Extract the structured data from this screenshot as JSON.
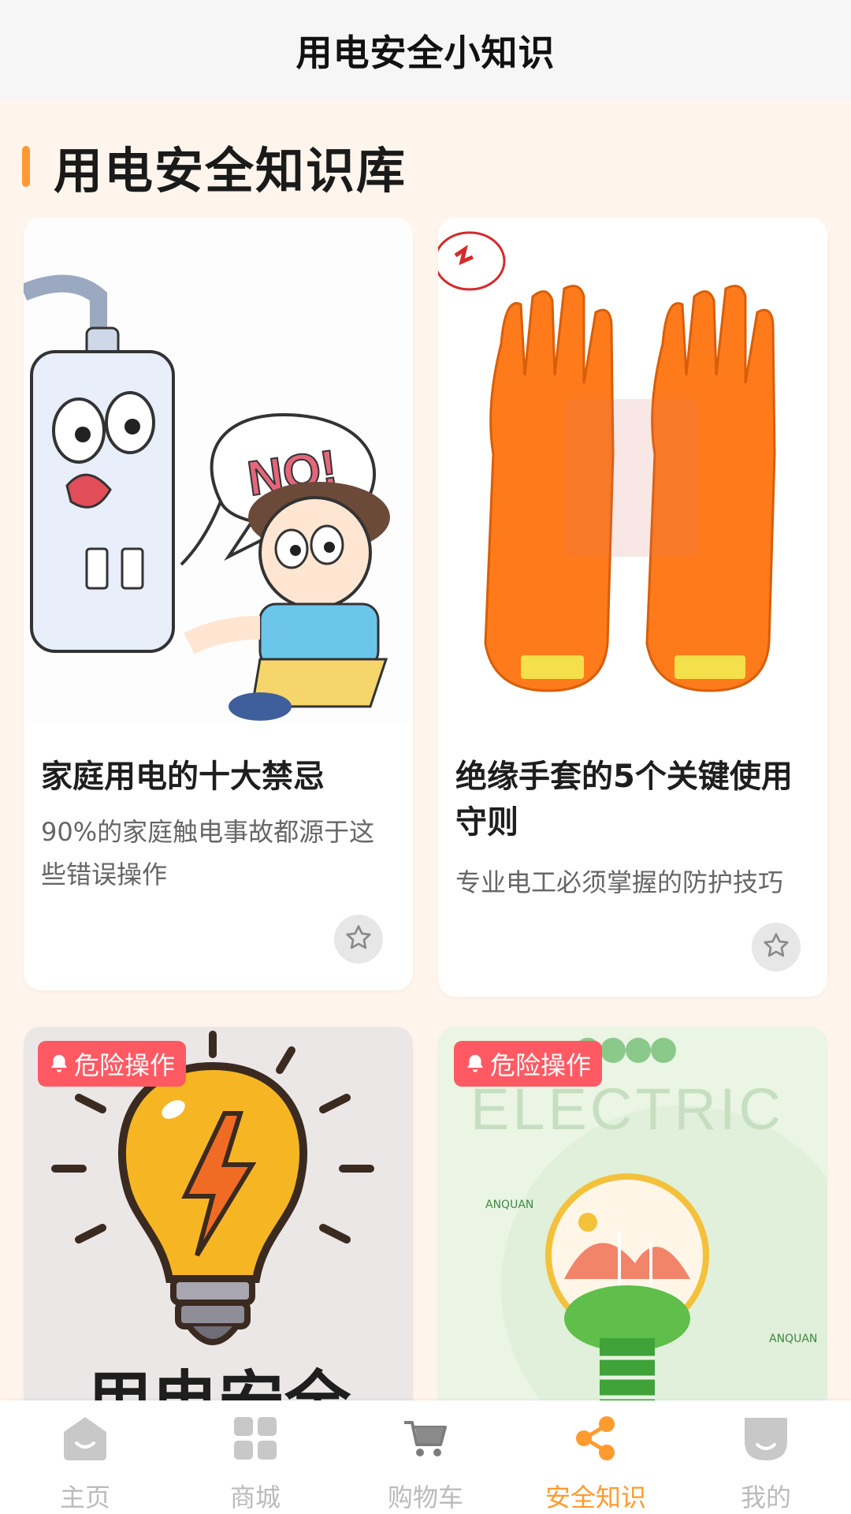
{
  "header": {
    "title": "用电安全小知识"
  },
  "section": {
    "title": "用电安全知识库"
  },
  "cards": [
    {
      "title": "家庭用电的十大禁忌",
      "desc": "90%的家庭触电事故都源于这些错误操作",
      "image": "cartoon-socket-no-illustration"
    },
    {
      "title": "绝缘手套的5个关键使用守则",
      "desc": "专业电工必须掌握的防护技巧",
      "image": "orange-insulating-gloves-photo"
    },
    {
      "badge": "危险操作",
      "image": "lightbulb-poster",
      "image_text": "用电安全"
    },
    {
      "badge": "危险操作",
      "image": "electric-green-poster",
      "image_text": "ELECTRIC"
    }
  ],
  "tabbar": {
    "active": "安全知识",
    "items": [
      {
        "label": "主页",
        "icon": "home-icon"
      },
      {
        "label": "商城",
        "icon": "grid-icon"
      },
      {
        "label": "购物车",
        "icon": "cart-icon"
      },
      {
        "label": "安全知识",
        "icon": "share-icon"
      },
      {
        "label": "我的",
        "icon": "profile-icon"
      }
    ]
  },
  "colors": {
    "accent": "#ff9b2f",
    "badge": "#ff5a63",
    "background": "#fff5ec"
  }
}
